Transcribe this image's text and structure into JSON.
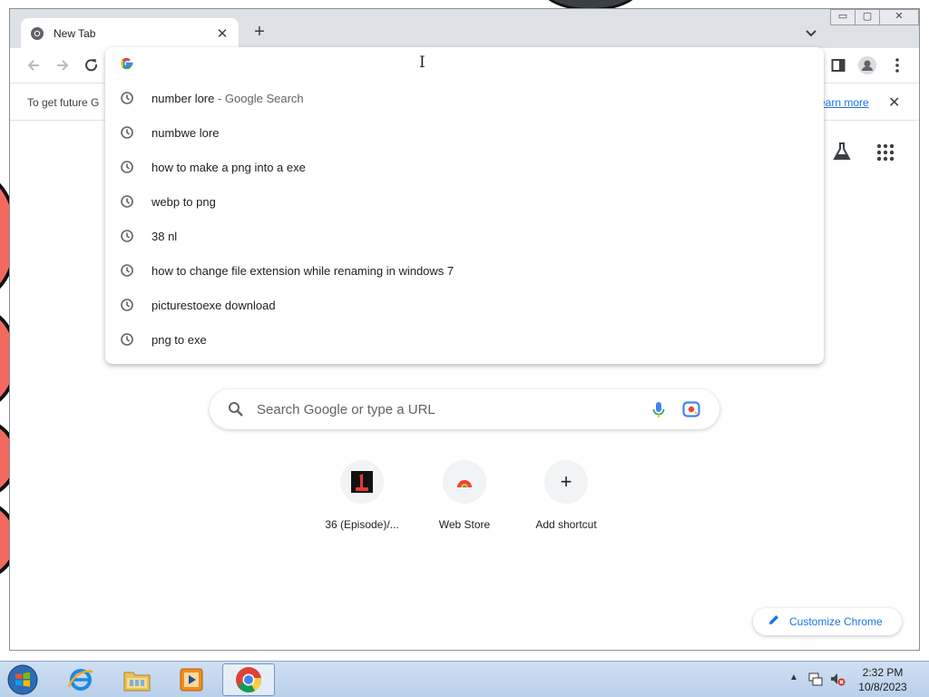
{
  "browser": {
    "tab": {
      "title": "New Tab",
      "close_glyph": "✕",
      "favicon": "chrome-icon"
    },
    "new_tab_glyph": "+",
    "window_controls": {
      "minimize": "▭",
      "maximize": "▢",
      "close": "✕"
    },
    "infobar": {
      "text": "To get future G",
      "link": "earn more",
      "close_glyph": "✕"
    }
  },
  "omnibox": {
    "suggestions": [
      {
        "text": "number lore",
        "hint": " - Google Search"
      },
      {
        "text": "numbwe lore",
        "hint": ""
      },
      {
        "text": "how to make a png into a exe",
        "hint": ""
      },
      {
        "text": "webp to png",
        "hint": ""
      },
      {
        "text": "38 nl",
        "hint": ""
      },
      {
        "text": "how to change file extension while renaming in windows 7",
        "hint": ""
      },
      {
        "text": "picturestoexe download",
        "hint": ""
      },
      {
        "text": "png to exe",
        "hint": ""
      }
    ]
  },
  "ntp": {
    "search_placeholder": "Search Google or type a URL",
    "shortcuts": [
      {
        "label": "36 (Episode)/..."
      },
      {
        "label": "Web Store"
      },
      {
        "label": "Add shortcut",
        "glyph": "+"
      }
    ],
    "customize_label": "Customize Chrome"
  },
  "taskbar": {
    "clock": {
      "time": "2:32 PM",
      "date": "10/8/2023"
    },
    "tray_arrow": "▲"
  },
  "colors": {
    "accent": "#1a73e8",
    "tabstrip": "#dee1e6",
    "wallpaper_blob": "#f26a5e"
  }
}
